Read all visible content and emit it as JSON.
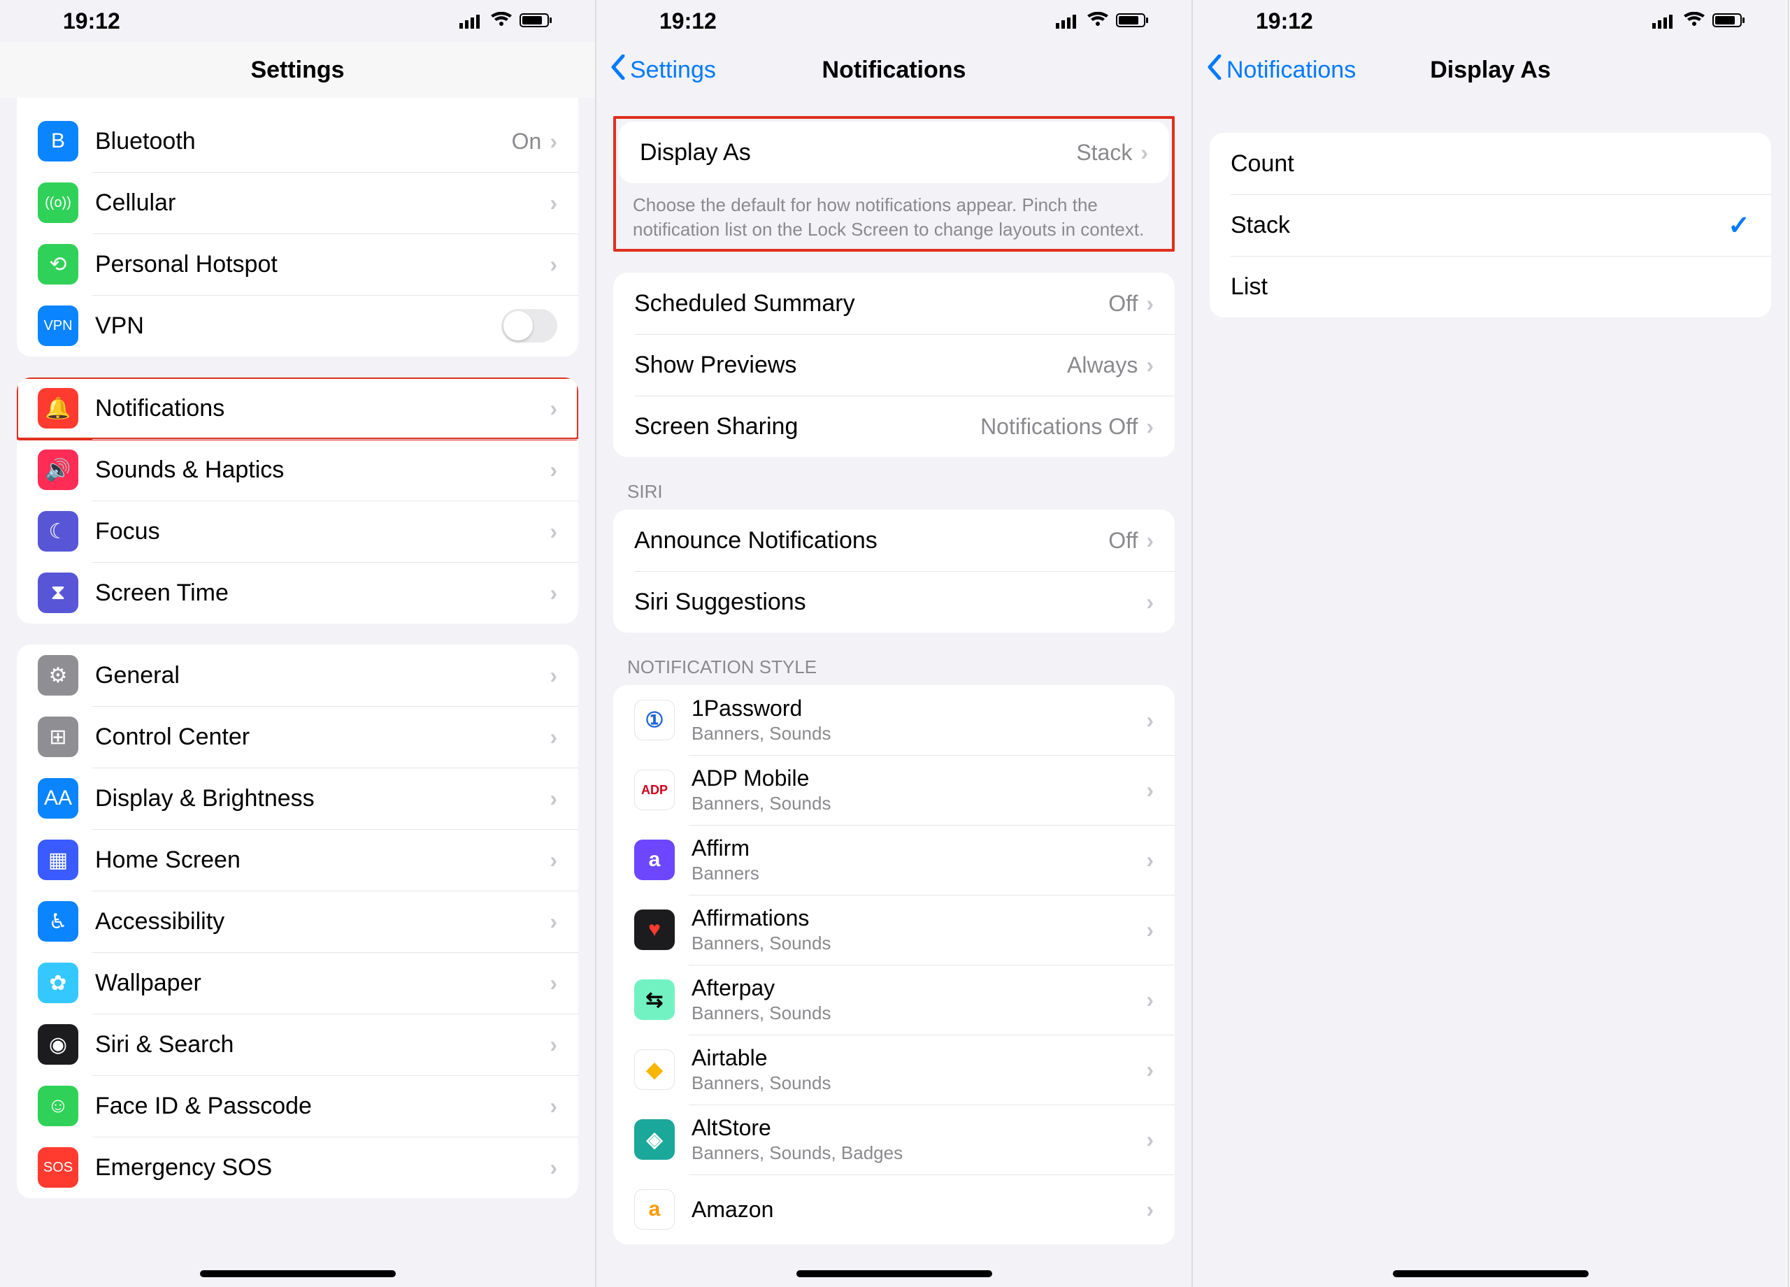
{
  "status": {
    "time": "19:12"
  },
  "screen1": {
    "title": "Settings",
    "groups": [
      {
        "rows": [
          {
            "icon_bg": "#0a84ff",
            "glyph": "B",
            "label": "Bluetooth",
            "detail": "On",
            "chev": true
          },
          {
            "icon_bg": "#30d158",
            "glyph": "((o))",
            "label": "Cellular",
            "chev": true
          },
          {
            "icon_bg": "#30d158",
            "glyph": "⟲",
            "label": "Personal Hotspot",
            "chev": true
          },
          {
            "icon_bg": "#0a84ff",
            "glyph": "VPN",
            "label": "VPN",
            "toggle": true
          }
        ]
      },
      {
        "rows": [
          {
            "icon_bg": "#ff3b30",
            "glyph": "🔔",
            "label": "Notifications",
            "chev": true,
            "hl": true
          },
          {
            "icon_bg": "#ff2d55",
            "glyph": "🔊",
            "label": "Sounds & Haptics",
            "chev": true
          },
          {
            "icon_bg": "#5856d6",
            "glyph": "☾",
            "label": "Focus",
            "chev": true
          },
          {
            "icon_bg": "#5856d6",
            "glyph": "⧗",
            "label": "Screen Time",
            "chev": true
          }
        ]
      },
      {
        "rows": [
          {
            "icon_bg": "#8e8e93",
            "glyph": "⚙︎",
            "label": "General",
            "chev": true
          },
          {
            "icon_bg": "#8e8e93",
            "glyph": "⊞",
            "label": "Control Center",
            "chev": true
          },
          {
            "icon_bg": "#0a84ff",
            "glyph": "AA",
            "label": "Display & Brightness",
            "chev": true
          },
          {
            "icon_bg": "#3a5bff",
            "glyph": "▦",
            "label": "Home Screen",
            "chev": true
          },
          {
            "icon_bg": "#0a84ff",
            "glyph": "♿︎",
            "label": "Accessibility",
            "chev": true
          },
          {
            "icon_bg": "#34c8ff",
            "glyph": "✿",
            "label": "Wallpaper",
            "chev": true
          },
          {
            "icon_bg": "#1c1c1e",
            "glyph": "◉",
            "label": "Siri & Search",
            "chev": true
          },
          {
            "icon_bg": "#30d158",
            "glyph": "☺︎",
            "label": "Face ID & Passcode",
            "chev": true
          },
          {
            "icon_bg": "#ff3b30",
            "glyph": "SOS",
            "label": "Emergency SOS",
            "chev": true
          }
        ]
      }
    ]
  },
  "screen2": {
    "back": "Settings",
    "title": "Notifications",
    "group1": {
      "row": {
        "label": "Display As",
        "detail": "Stack"
      },
      "footer": "Choose the default for how notifications appear. Pinch the notification list on the Lock Screen to change layouts in context."
    },
    "group2": [
      {
        "label": "Scheduled Summary",
        "detail": "Off"
      },
      {
        "label": "Show Previews",
        "detail": "Always"
      },
      {
        "label": "Screen Sharing",
        "detail": "Notifications Off"
      }
    ],
    "siri_header": "SIRI",
    "group3": [
      {
        "label": "Announce Notifications",
        "detail": "Off"
      },
      {
        "label": "Siri Suggestions",
        "detail": ""
      }
    ],
    "style_header": "NOTIFICATION STYLE",
    "apps": [
      {
        "name": "1Password",
        "sub": "Banners, Sounds",
        "bg": "#ffffff",
        "fg": "#1a63d9",
        "g": "①"
      },
      {
        "name": "ADP Mobile",
        "sub": "Banners, Sounds",
        "bg": "#ffffff",
        "fg": "#d0021b",
        "g": "ADP"
      },
      {
        "name": "Affirm",
        "sub": "Banners",
        "bg": "#6c47ff",
        "fg": "#fff",
        "g": "a"
      },
      {
        "name": "Affirmations",
        "sub": "Banners, Sounds",
        "bg": "#1c1c1e",
        "fg": "#ff3b30",
        "g": "♥"
      },
      {
        "name": "Afterpay",
        "sub": "Banners, Sounds",
        "bg": "#72f2c3",
        "fg": "#000",
        "g": "⇆"
      },
      {
        "name": "Airtable",
        "sub": "Banners, Sounds",
        "bg": "#ffffff",
        "fg": "#f7b500",
        "g": "◆"
      },
      {
        "name": "AltStore",
        "sub": "Banners, Sounds, Badges",
        "bg": "#1aa89a",
        "fg": "#fff",
        "g": "◈"
      },
      {
        "name": "Amazon",
        "sub": "",
        "bg": "#ffffff",
        "fg": "#ff9900",
        "g": "a"
      }
    ]
  },
  "screen3": {
    "back": "Notifications",
    "title": "Display As",
    "options": [
      {
        "label": "Count",
        "checked": false
      },
      {
        "label": "Stack",
        "checked": true
      },
      {
        "label": "List",
        "checked": false
      }
    ]
  }
}
